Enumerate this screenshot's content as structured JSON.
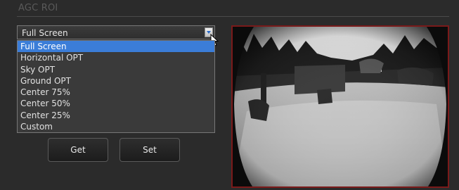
{
  "section": {
    "title": "AGC ROI"
  },
  "roi_select": {
    "value": "Full Screen",
    "options": [
      "Full Screen",
      "Horizontal OPT",
      "Sky OPT",
      "Ground OPT",
      "Center 75%",
      "Center 50%",
      "Center 25%",
      "Custom"
    ],
    "selected_index": 0,
    "highlight_color": "#3b7dd8"
  },
  "buttons": {
    "get_label": "Get",
    "set_label": "Set"
  },
  "preview": {
    "border_color": "#7a1a1a"
  }
}
